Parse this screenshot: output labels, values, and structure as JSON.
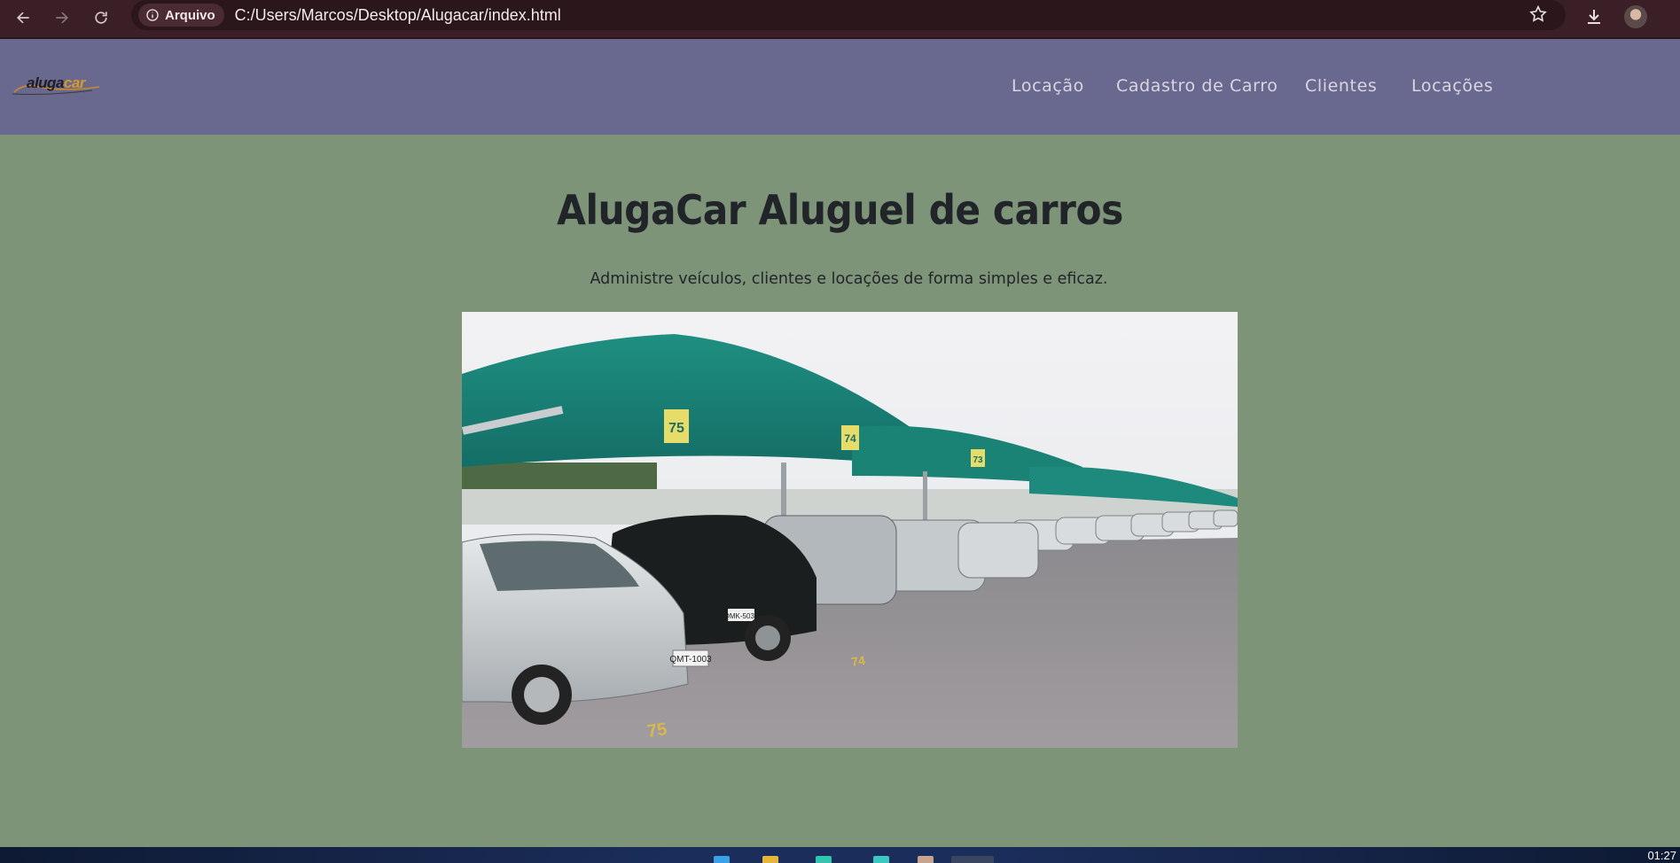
{
  "browser": {
    "site_chip_label": "Arquivo",
    "url": "C:/Users/Marcos/Desktop/Alugacar/index.html",
    "icons": [
      "back-icon",
      "forward-icon",
      "reload-icon",
      "info-icon",
      "star-icon",
      "download-icon",
      "profile-avatar"
    ]
  },
  "header": {
    "logo_part1": "aluga",
    "logo_part2": "car",
    "menu": [
      "Locação",
      "Cadastro de Carro",
      "Clientes",
      "Locações"
    ]
  },
  "main": {
    "title": "AlugaCar Aluguel de carros",
    "subtitle": "Administre veículos, clientes e locações de forma simples e eficaz."
  },
  "hero_image": {
    "description_icon": "car-lot-photo",
    "space_numbers": [
      "75",
      "74",
      "73"
    ],
    "plates": [
      "QMT-1003",
      "QMK-5030"
    ]
  },
  "taskbar": {
    "clock": "01:27"
  },
  "colors": {
    "page_bg": "#7e9479",
    "header_bg": "#69688e",
    "menu_text": "#d9d6e2",
    "title_text": "#212529",
    "browser_bg": "#3b1f27"
  }
}
